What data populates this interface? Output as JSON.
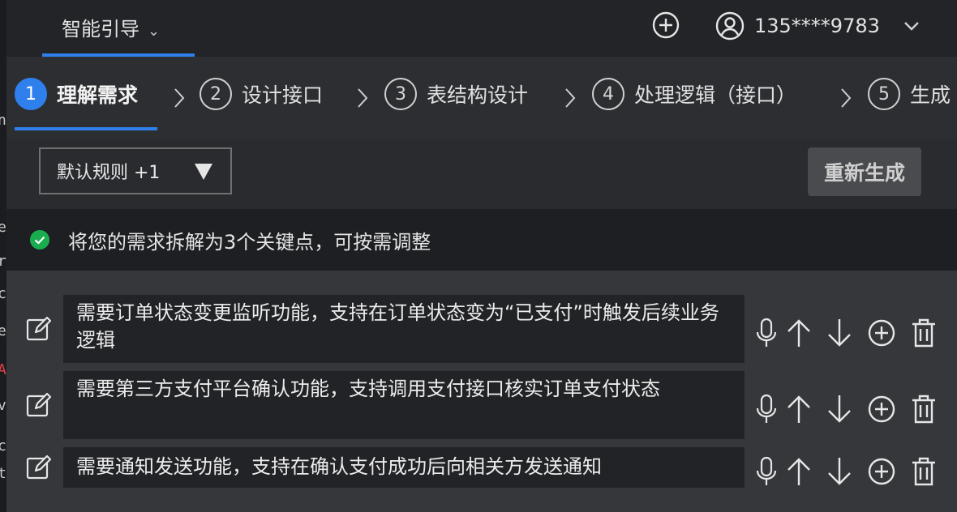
{
  "header": {
    "brand_label": "智能引导",
    "brand_chevron": "⌄",
    "user_name": "135****9783",
    "icons": [
      "plus-circle-icon",
      "user-avatar-icon",
      "chevron-down-icon"
    ]
  },
  "steps": [
    {
      "num": "1",
      "label": "理解需求",
      "active": true
    },
    {
      "num": "2",
      "label": "设计接口"
    },
    {
      "num": "3",
      "label": "表结构设计"
    },
    {
      "num": "4",
      "label": "处理逻辑（接口）"
    },
    {
      "num": "5",
      "label": "生成"
    }
  ],
  "toolbar": {
    "rules_label": "默认规则 +1",
    "regen_label": "重新生成"
  },
  "notice": {
    "text": "将您的需求拆解为3个关键点，可按需调整"
  },
  "requirements": [
    {
      "text": "需要订单状态变更监听功能，支持在订单状态变为“已支付”时触发后续业务逻辑"
    },
    {
      "text": "需要第三方支付平台确认功能，支持调用支付接口核实订单支付状态"
    },
    {
      "text": "需要通知发送功能，支持在确认支付成功后向相关方发送通知"
    }
  ],
  "row_actions": [
    "microphone-icon",
    "arrow-up-icon",
    "arrow-down-icon",
    "plus-circle-icon",
    "trash-icon"
  ],
  "colors": {
    "accent": "#2f80ed",
    "success": "#1aad4f",
    "background": "#232428"
  }
}
